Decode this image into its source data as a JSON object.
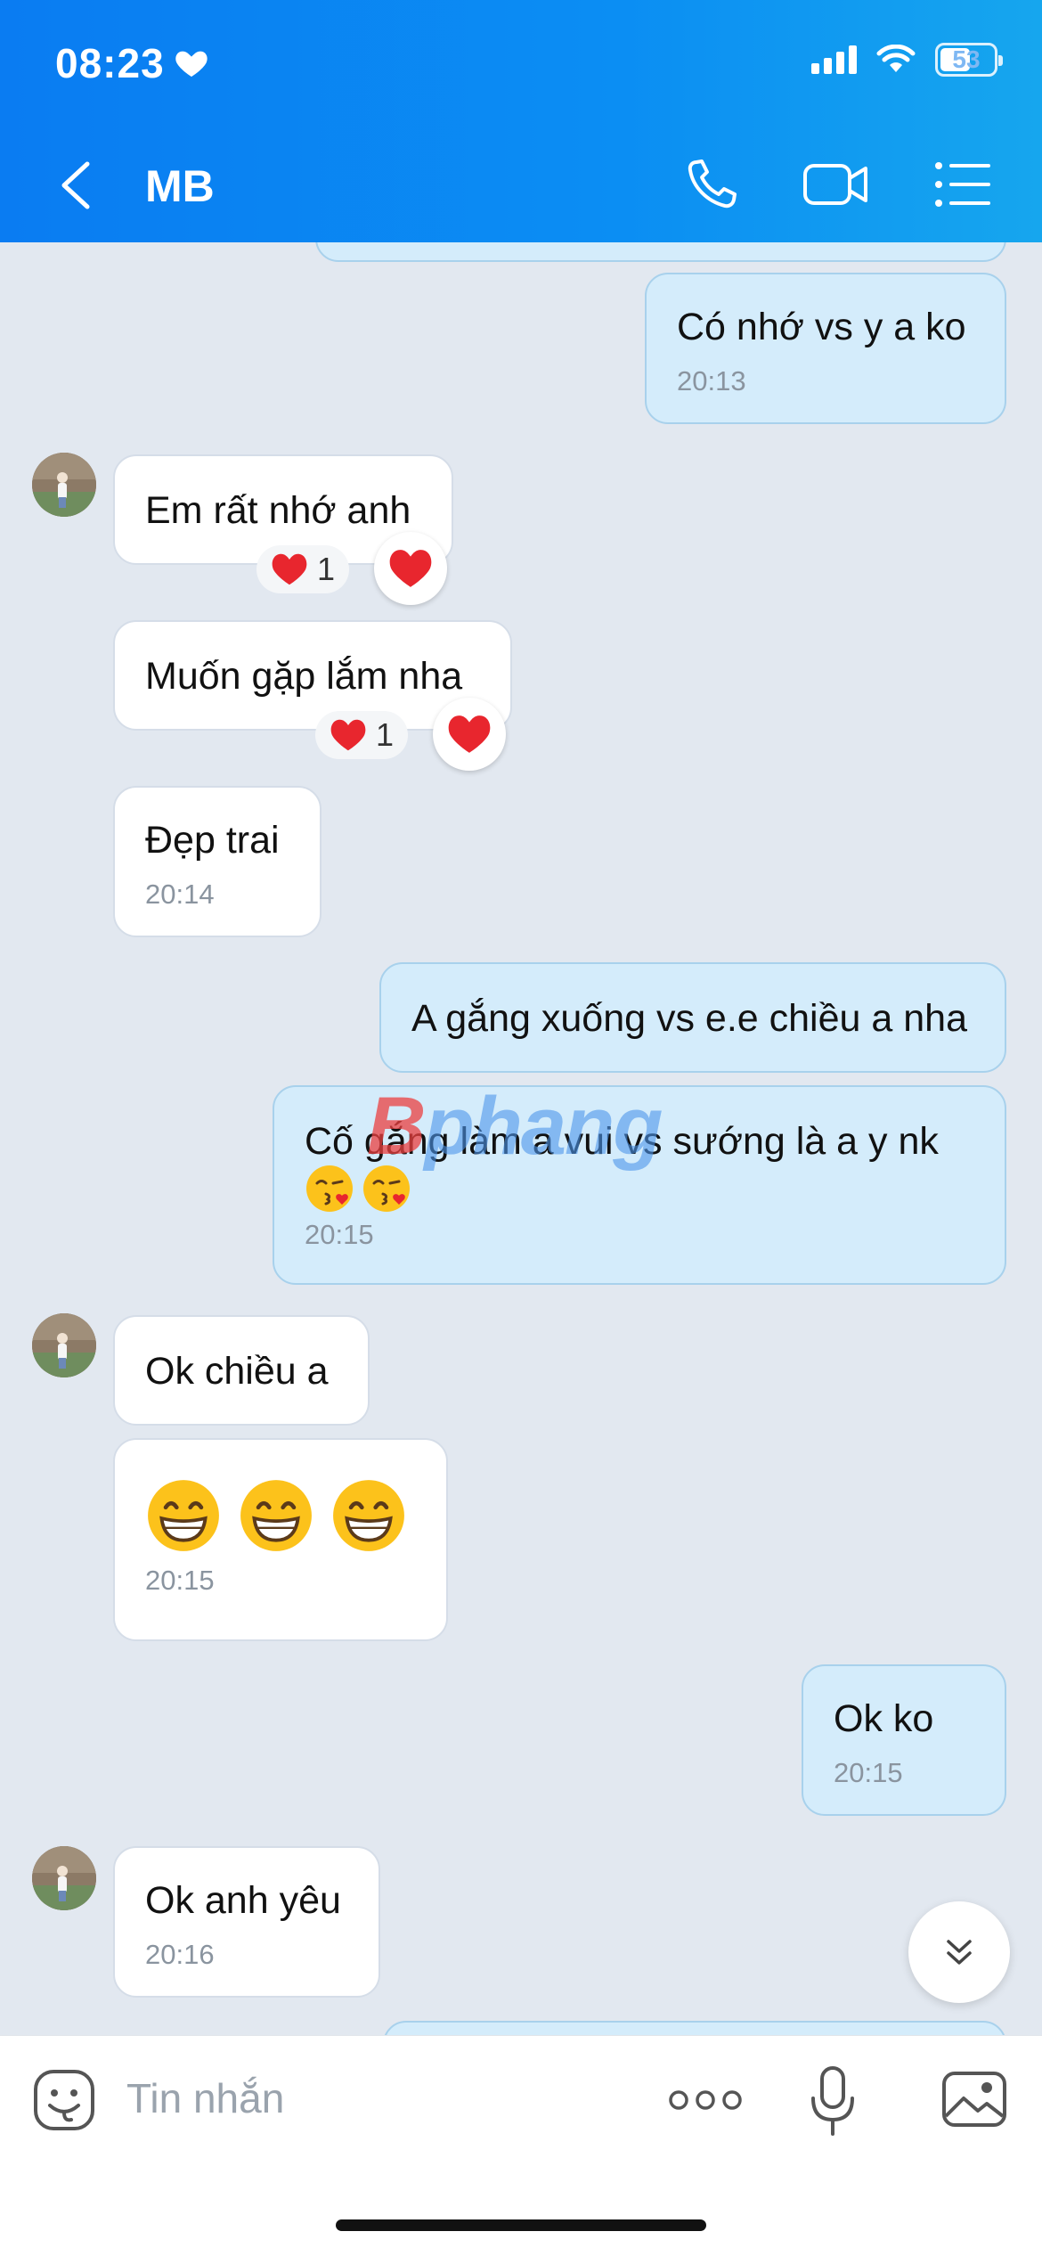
{
  "status_bar": {
    "time": "08:23",
    "battery": "53"
  },
  "header": {
    "contact_name": "MB"
  },
  "messages": [
    {
      "direction": "out",
      "text": "Có nhớ vs y a ko",
      "time": "20:13"
    },
    {
      "direction": "in",
      "text": "Em rất nhớ anh",
      "reaction_count": "1"
    },
    {
      "direction": "in",
      "text": "Muốn gặp lắm nha",
      "reaction_count": "1"
    },
    {
      "direction": "in",
      "text": "Đẹp trai",
      "time": "20:14"
    },
    {
      "direction": "out",
      "text": "A gắng xuống vs e.e chiều a nha"
    },
    {
      "direction": "out",
      "text": "Cố gắng làm a vui vs sướng là a y nk",
      "time": "20:15"
    },
    {
      "direction": "in",
      "text": "Ok chiều a"
    },
    {
      "direction": "in",
      "text": "",
      "time": "20:15"
    },
    {
      "direction": "out",
      "text": "Ok ko",
      "time": "20:15"
    },
    {
      "direction": "in",
      "text": "Ok anh yêu",
      "time": "20:16"
    }
  ],
  "watermark": {
    "part1": "B",
    "part2": "phang"
  },
  "input": {
    "placeholder": "Tin nhắn"
  },
  "colors": {
    "header": "#0a7cf2",
    "outgoing_bubble": "#d4ecfb",
    "incoming_bubble": "#ffffff",
    "background": "#e2e8f0"
  },
  "icons": [
    "heart-icon",
    "signal-icon",
    "wifi-icon",
    "battery-icon",
    "back-icon",
    "phone-icon",
    "video-call-icon",
    "menu-list-icon",
    "red-heart-icon",
    "kissing-face-emoji",
    "grinning-face-emoji",
    "double-chevron-down-icon",
    "sticker-icon",
    "more-icon",
    "microphone-icon",
    "image-icon"
  ]
}
